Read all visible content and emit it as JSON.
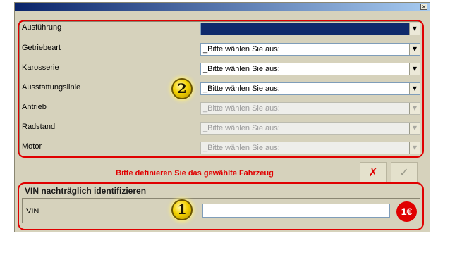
{
  "window": {
    "close_glyph": "×"
  },
  "vehicle_form": {
    "rows": [
      {
        "label": "Ausführung",
        "value": "",
        "enabled": true
      },
      {
        "label": "Getriebeart",
        "value": "_Bitte wählen Sie aus:",
        "enabled": true
      },
      {
        "label": "Karosserie",
        "value": "_Bitte wählen Sie aus:",
        "enabled": true
      },
      {
        "label": "Ausstattungslinie",
        "value": "_Bitte wählen Sie aus:",
        "enabled": true
      },
      {
        "label": "Antrieb",
        "value": "_Bitte wählen Sie aus:",
        "enabled": false
      },
      {
        "label": "Radstand",
        "value": "_Bitte wählen Sie aus:",
        "enabled": false
      },
      {
        "label": "Motor",
        "value": "_Bitte wählen Sie aus:",
        "enabled": false
      }
    ],
    "step_badge": "2"
  },
  "status_message": "Bitte definieren Sie das gewählte Fahrzeug",
  "actions": {
    "cancel_icon": "red-x-icon",
    "confirm_icon": "checkmark-icon",
    "cancel_glyph": "✗",
    "confirm_glyph": "✓"
  },
  "vin_section": {
    "title": "VIN nachträglich identifizieren",
    "label": "VIN",
    "value": "",
    "step_badge": "1",
    "price_badge": "1€"
  },
  "colors": {
    "highlight_border": "#e00000",
    "dialog_background": "#d6d2bc",
    "selected_combo": "#0f2a6b"
  }
}
